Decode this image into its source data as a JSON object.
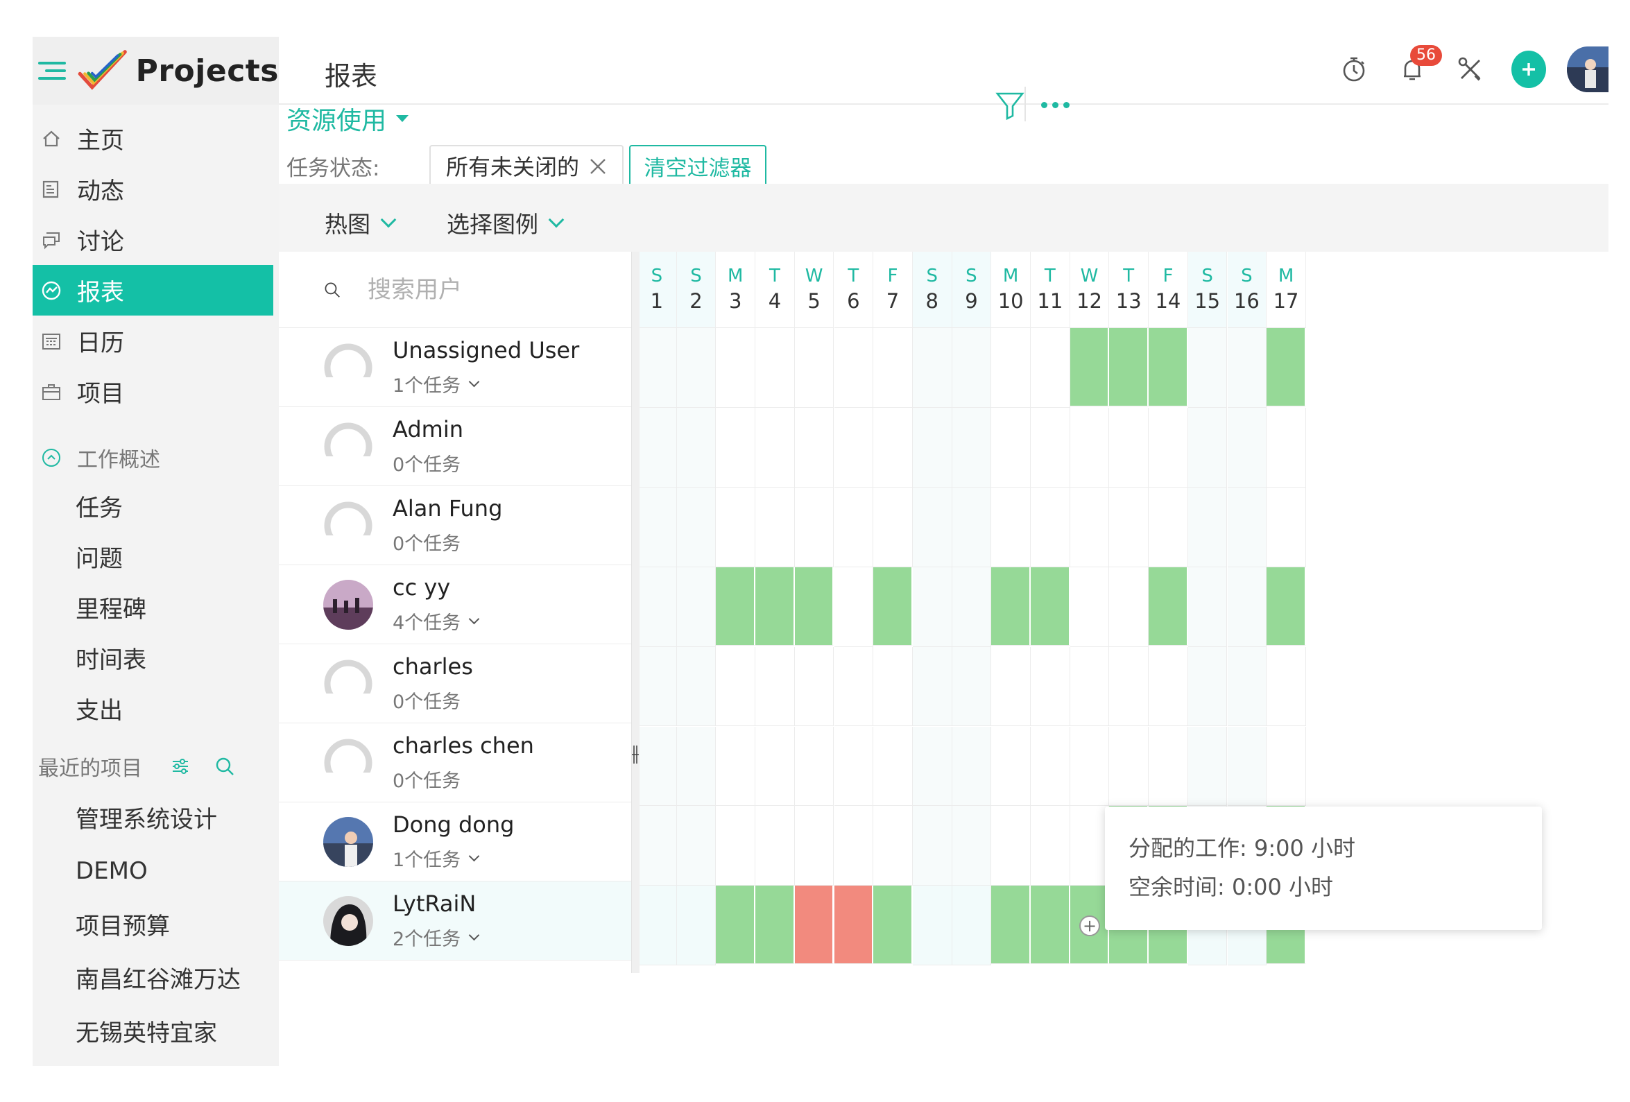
{
  "app": {
    "logo_text": "Projects"
  },
  "header": {
    "title": "报表",
    "notification_count": "56"
  },
  "sidebar": {
    "nav": [
      {
        "label": "主页",
        "icon": "home-icon"
      },
      {
        "label": "动态",
        "icon": "feed-icon"
      },
      {
        "label": "讨论",
        "icon": "chat-icon"
      },
      {
        "label": "报表",
        "icon": "report-icon",
        "active": true
      },
      {
        "label": "日历",
        "icon": "calendar-icon"
      },
      {
        "label": "项目",
        "icon": "briefcase-icon"
      }
    ],
    "work_overview": {
      "label": "工作概述",
      "items": [
        "任务",
        "问题",
        "里程碑",
        "时间表",
        "支出"
      ]
    },
    "recent": {
      "label": "最近的项目",
      "items": [
        "管理系统设计",
        "DEMO",
        "项目预算",
        "南昌红谷滩万达",
        "无锡英特宜家"
      ]
    }
  },
  "toolbar": {
    "view": "资源使用",
    "filter_label": "任务状态:",
    "filter_value": "所有未关闭的",
    "clear_filter": "清空过滤器",
    "chart_type": "热图",
    "legend_select": "选择图例",
    "search_placeholder": "搜索用户"
  },
  "days": [
    {
      "l": "S",
      "n": "1",
      "we": true
    },
    {
      "l": "S",
      "n": "2",
      "we": true
    },
    {
      "l": "M",
      "n": "3"
    },
    {
      "l": "T",
      "n": "4"
    },
    {
      "l": "W",
      "n": "5"
    },
    {
      "l": "T",
      "n": "6"
    },
    {
      "l": "F",
      "n": "7"
    },
    {
      "l": "S",
      "n": "8",
      "we": true
    },
    {
      "l": "S",
      "n": "9",
      "we": true
    },
    {
      "l": "M",
      "n": "10"
    },
    {
      "l": "T",
      "n": "11"
    },
    {
      "l": "W",
      "n": "12"
    },
    {
      "l": "T",
      "n": "13"
    },
    {
      "l": "F",
      "n": "14"
    },
    {
      "l": "S",
      "n": "15",
      "we": true
    },
    {
      "l": "S",
      "n": "16",
      "we": true
    },
    {
      "l": "M",
      "n": "17"
    }
  ],
  "users": [
    {
      "name": "Unassigned User",
      "tasks": "1个任务",
      "expandable": true,
      "avatar": "default",
      "cells": {
        "12": "g",
        "13": "g",
        "14": "g",
        "17": "g"
      }
    },
    {
      "name": "Admin",
      "tasks": "0个任务",
      "expandable": false,
      "avatar": "default",
      "cells": {}
    },
    {
      "name": "Alan Fung",
      "tasks": "0个任务",
      "expandable": false,
      "avatar": "default",
      "cells": {}
    },
    {
      "name": "cc yy",
      "tasks": "4个任务",
      "expandable": true,
      "avatar": "photo1",
      "cells": {
        "3": "g",
        "4": "g",
        "5": "g",
        "7": "g",
        "10": "g",
        "11": "g",
        "14": "g",
        "17": "g"
      }
    },
    {
      "name": "charles",
      "tasks": "0个任务",
      "expandable": false,
      "avatar": "default",
      "cells": {}
    },
    {
      "name": "charles chen",
      "tasks": "0个任务",
      "expandable": false,
      "avatar": "default",
      "cells": {}
    },
    {
      "name": "Dong dong",
      "tasks": "1个任务",
      "expandable": true,
      "avatar": "photo2",
      "cells": {
        "13": "g",
        "14": "g",
        "17": "g"
      }
    },
    {
      "name": "LytRaiN",
      "tasks": "2个任务",
      "expandable": true,
      "avatar": "photo3",
      "highlight": true,
      "cells": {
        "3": "g",
        "4": "g",
        "5": "r",
        "6": "r",
        "7": "g",
        "10": "g",
        "11": "g",
        "12": "g",
        "13": "g",
        "14": "g",
        "17": "g"
      }
    }
  ],
  "tooltip": {
    "allocated": "分配的工作: 9:00 小时",
    "free": "空余时间: 0:00 小时"
  },
  "colors": {
    "accent": "#14c0a6",
    "ok": "#96d997",
    "over": "#f28a7e"
  }
}
